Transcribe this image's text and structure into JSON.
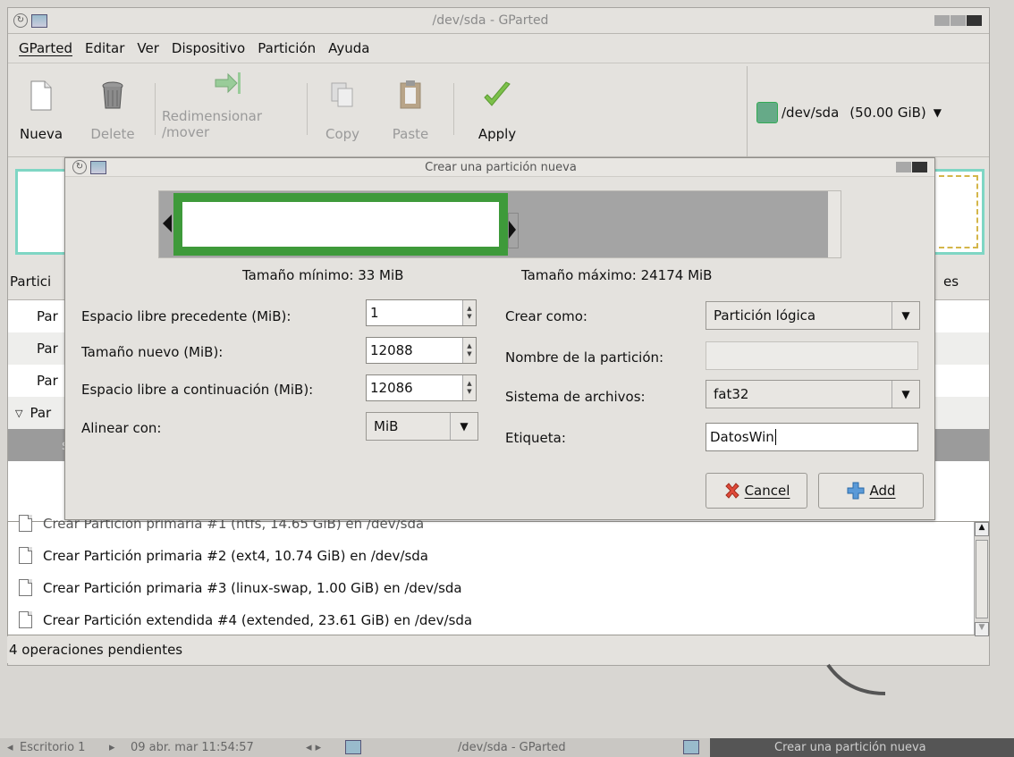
{
  "window": {
    "title": "/dev/sda - GParted"
  },
  "menu": [
    "GParted",
    "Editar",
    "Ver",
    "Dispositivo",
    "Partición",
    "Ayuda"
  ],
  "toolbar": {
    "new": "Nueva",
    "delete": "Delete",
    "resize_1": "Redimensionar",
    "resize_2": "/mover",
    "copy": "Copy",
    "paste": "Paste",
    "apply": "Apply"
  },
  "device": {
    "name": "/dev/sda",
    "size": "(50.00 GiB)"
  },
  "partition_list": {
    "col_partition": "Partici",
    "col_flags": "es",
    "rows": [
      "Par",
      "Par",
      "Par",
      "Par",
      "s"
    ]
  },
  "dialog": {
    "title": "Crear una partición nueva",
    "min_size": "Tamaño mínimo: 33 MiB",
    "max_size": "Tamaño máximo: 24174 MiB",
    "free_before_label": "Espacio libre precedente (MiB):",
    "free_before_value": "1",
    "new_size_label": "Tamaño nuevo (MiB):",
    "new_size_value": "12088",
    "free_after_label": "Espacio libre a continuación (MiB):",
    "free_after_value": "12086",
    "align_label": "Alinear con:",
    "align_value": "MiB",
    "create_as_label": "Crear como:",
    "create_as_value": "Partición lógica",
    "partition_name_label": "Nombre de la partición:",
    "partition_name_value": "",
    "filesystem_label": "Sistema de archivos:",
    "filesystem_value": "fat32",
    "label_label": "Etiqueta:",
    "label_value": "DatosWin",
    "cancel": "Cancel",
    "add": "Add",
    "bar_fill_fraction": 0.5
  },
  "operations": [
    "Crear Partición primaria #1 (ntfs, 14.65 GiB) en /dev/sda",
    "Crear Partición primaria #2 (ext4, 10.74 GiB) en /dev/sda",
    "Crear Partición primaria #3 (linux-swap, 1.00 GiB) en /dev/sda",
    "Crear Partición extendida #4 (extended, 23.61 GiB) en /dev/sda"
  ],
  "status": "4 operaciones pendientes",
  "taskbar": {
    "desktop": "Escritorio 1",
    "datetime": "09 abr. mar 11:54:57",
    "task1": "/dev/sda - GParted",
    "task2": "Crear una partición nueva"
  },
  "colors": {
    "partition_fill": "#3e9a3a",
    "unallocated": "#a4a4a4",
    "highlight": "#7fd6c4"
  }
}
